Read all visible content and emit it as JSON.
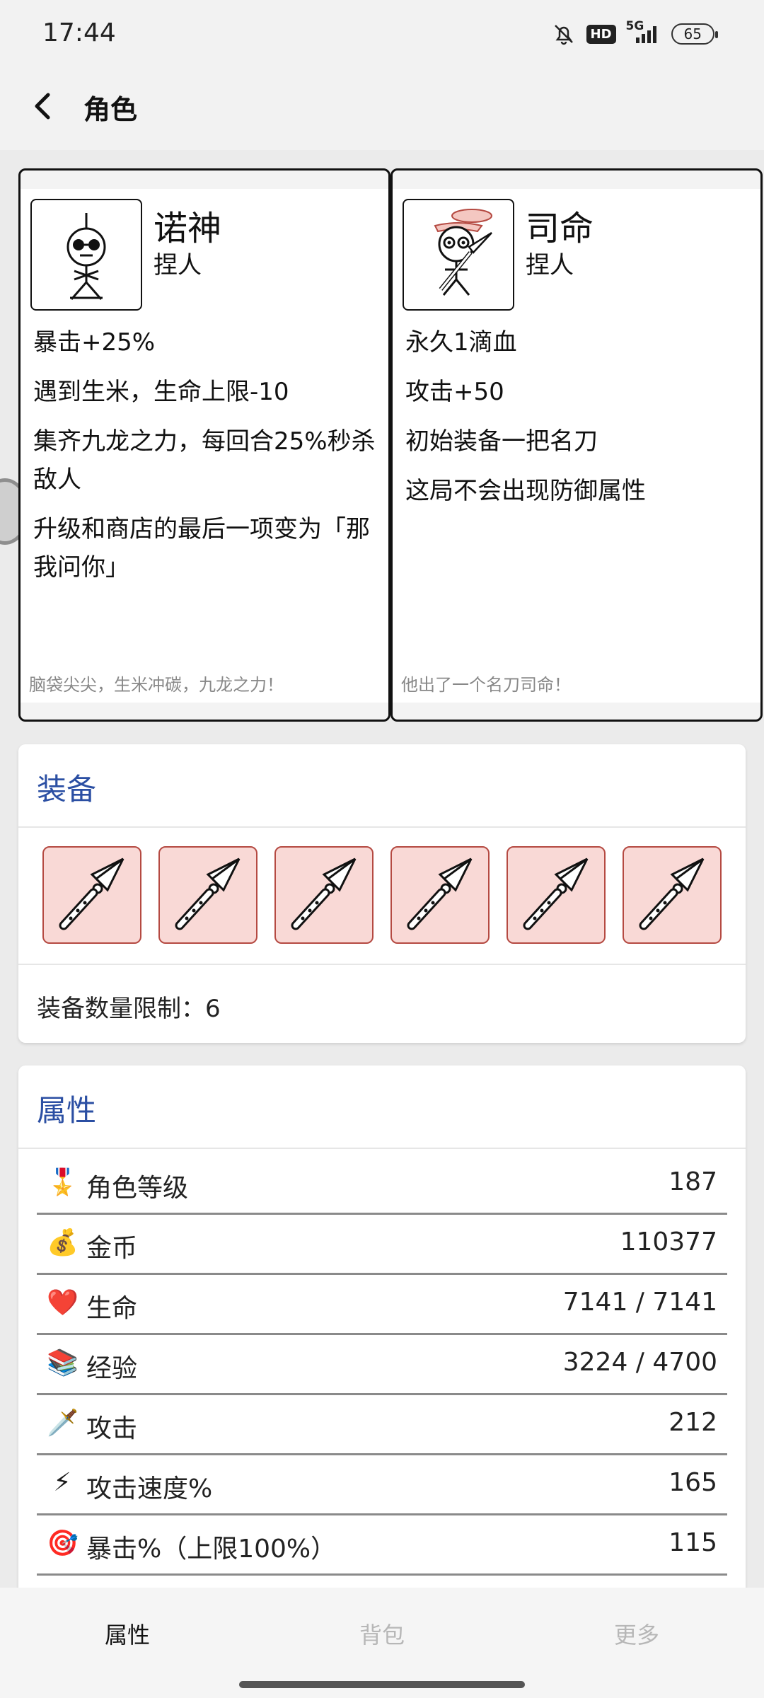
{
  "status_bar": {
    "time": "17:44",
    "net_label": "5G",
    "hd_label": "HD",
    "battery": "65",
    "icons": [
      "mute-bell-icon",
      "hd-icon",
      "signal-icon",
      "battery-icon"
    ]
  },
  "header": {
    "title": "角色",
    "back_icon": "back-arrow-icon"
  },
  "roles": [
    {
      "name": "诺神",
      "subtitle": "捏人",
      "skills": [
        "暴击+25%",
        "遇到生米，生命上限-10",
        "集齐九龙之力，每回合25%秒杀敌人",
        "升级和商店的最后一项变为「那我问你」"
      ],
      "tagline": "脑袋尖尖，生米冲碳，九龙之力！"
    },
    {
      "name": "司命",
      "subtitle": "捏人",
      "skills": [
        "永久1滴血",
        "攻击+50",
        "初始装备一把名刀",
        "这局不会出现防御属性"
      ],
      "tagline": "他出了一个名刀司命！"
    }
  ],
  "equipment": {
    "title": "装备",
    "slots": [
      "knife-icon",
      "knife-icon",
      "knife-icon",
      "knife-icon",
      "knife-icon",
      "knife-icon"
    ],
    "limit_text": "装备数量限制：6"
  },
  "attributes": {
    "title": "属性",
    "rows": [
      {
        "icon": "🎖️",
        "label": "角色等级",
        "value": "187"
      },
      {
        "icon": "💰",
        "label": "金币",
        "value": "110377"
      },
      {
        "icon": "❤️",
        "label": "生命",
        "value": "7141 / 7141"
      },
      {
        "icon": "📚",
        "label": "经验",
        "value": "3224 / 4700"
      },
      {
        "icon": "🗡️",
        "label": "攻击",
        "value": "212"
      },
      {
        "icon": "⚡",
        "label": "攻击速度%",
        "value": "165"
      },
      {
        "icon": "🎯",
        "label": "暴击%（上限100%）",
        "value": "115"
      }
    ]
  },
  "bottom_nav": {
    "tabs": [
      "属性",
      "背包",
      "更多"
    ],
    "active": "属性"
  },
  "colors": {
    "accent": "#2b4fa3",
    "slot_bg": "#f9d9d6",
    "slot_border": "#b54a42"
  }
}
